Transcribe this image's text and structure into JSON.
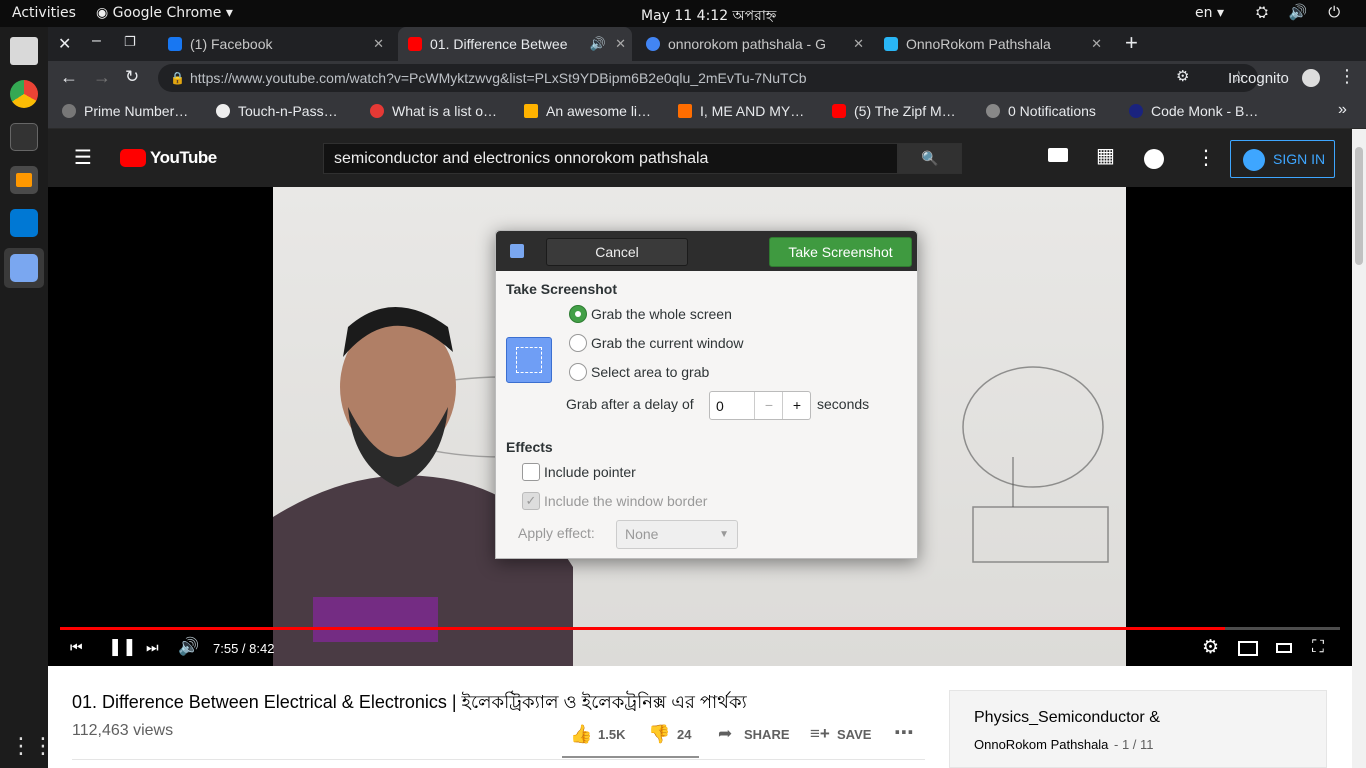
{
  "topbar": {
    "activities": "Activities",
    "app": "Google Chrome",
    "clock": "May 11   4:12 অপরাহ্ন",
    "lang": "en",
    "system_icons": "⛭ 🔊 ⏻"
  },
  "tabs": [
    {
      "label": "(1) Facebook",
      "fav_color": "#1877f2"
    },
    {
      "label": "01. Difference Betwee",
      "fav_color": "#ff0000"
    },
    {
      "label": "onnorokom pathshala - G",
      "fav_color": "#4285f4"
    },
    {
      "label": "OnnoRokom Pathshala",
      "fav_color": "#29b6f6"
    }
  ],
  "browser": {
    "url": "https://www.youtube.com/watch?v=PcWMyktzwvg&list=PLxSt9YDBipm6B2e0qlu_2mEvTu-7NuTCb",
    "incognito": "Incognito"
  },
  "bookmarks": [
    {
      "label": "Prime Number…",
      "color": "#777"
    },
    {
      "label": "Touch-n-Pass…",
      "color": "#eee"
    },
    {
      "label": "What is a list o…",
      "color": "#e53935"
    },
    {
      "label": "An awesome li…",
      "color": "#ffb300"
    },
    {
      "label": "I, ME AND MY…",
      "color": "#ff6d00"
    },
    {
      "label": "(5) The Zipf M…",
      "color": "#ff0000"
    },
    {
      "label": "0 Notifications",
      "color": "#888"
    },
    {
      "label": "Code Monk - B…",
      "color": "#1a237e"
    }
  ],
  "youtube": {
    "logo": "YouTube",
    "search_value": "semiconductor and electronics onnorokom pathshala",
    "signin": "SIGN IN",
    "time": "7:55 / 8:42",
    "progress": 0.91,
    "title": "01. Difference Between Electrical & Electronics | ইলেকট্রিক্যাল ও ইলেকট্রনিক্স এর পার্থক্য",
    "views": "112,463 views",
    "likes": "1.5K",
    "dislikes": "24",
    "share": "SHARE",
    "save": "SAVE",
    "playlist_title": "Physics_Semiconductor &",
    "playlist_channel": "OnnoRokom Pathshala",
    "playlist_pos": "- 1 / 11"
  },
  "dialog": {
    "cancel": "Cancel",
    "take": "Take Screenshot",
    "section1": "Take Screenshot",
    "opt_whole": "Grab the whole screen",
    "opt_window": "Grab the current window",
    "opt_area": "Select area to grab",
    "delay_label": "Grab after a delay of",
    "delay_value": "0",
    "delay_unit": "seconds",
    "section2": "Effects",
    "include_pointer": "Include pointer",
    "include_border": "Include the window border",
    "apply_effect": "Apply effect:",
    "effect_value": "None"
  }
}
